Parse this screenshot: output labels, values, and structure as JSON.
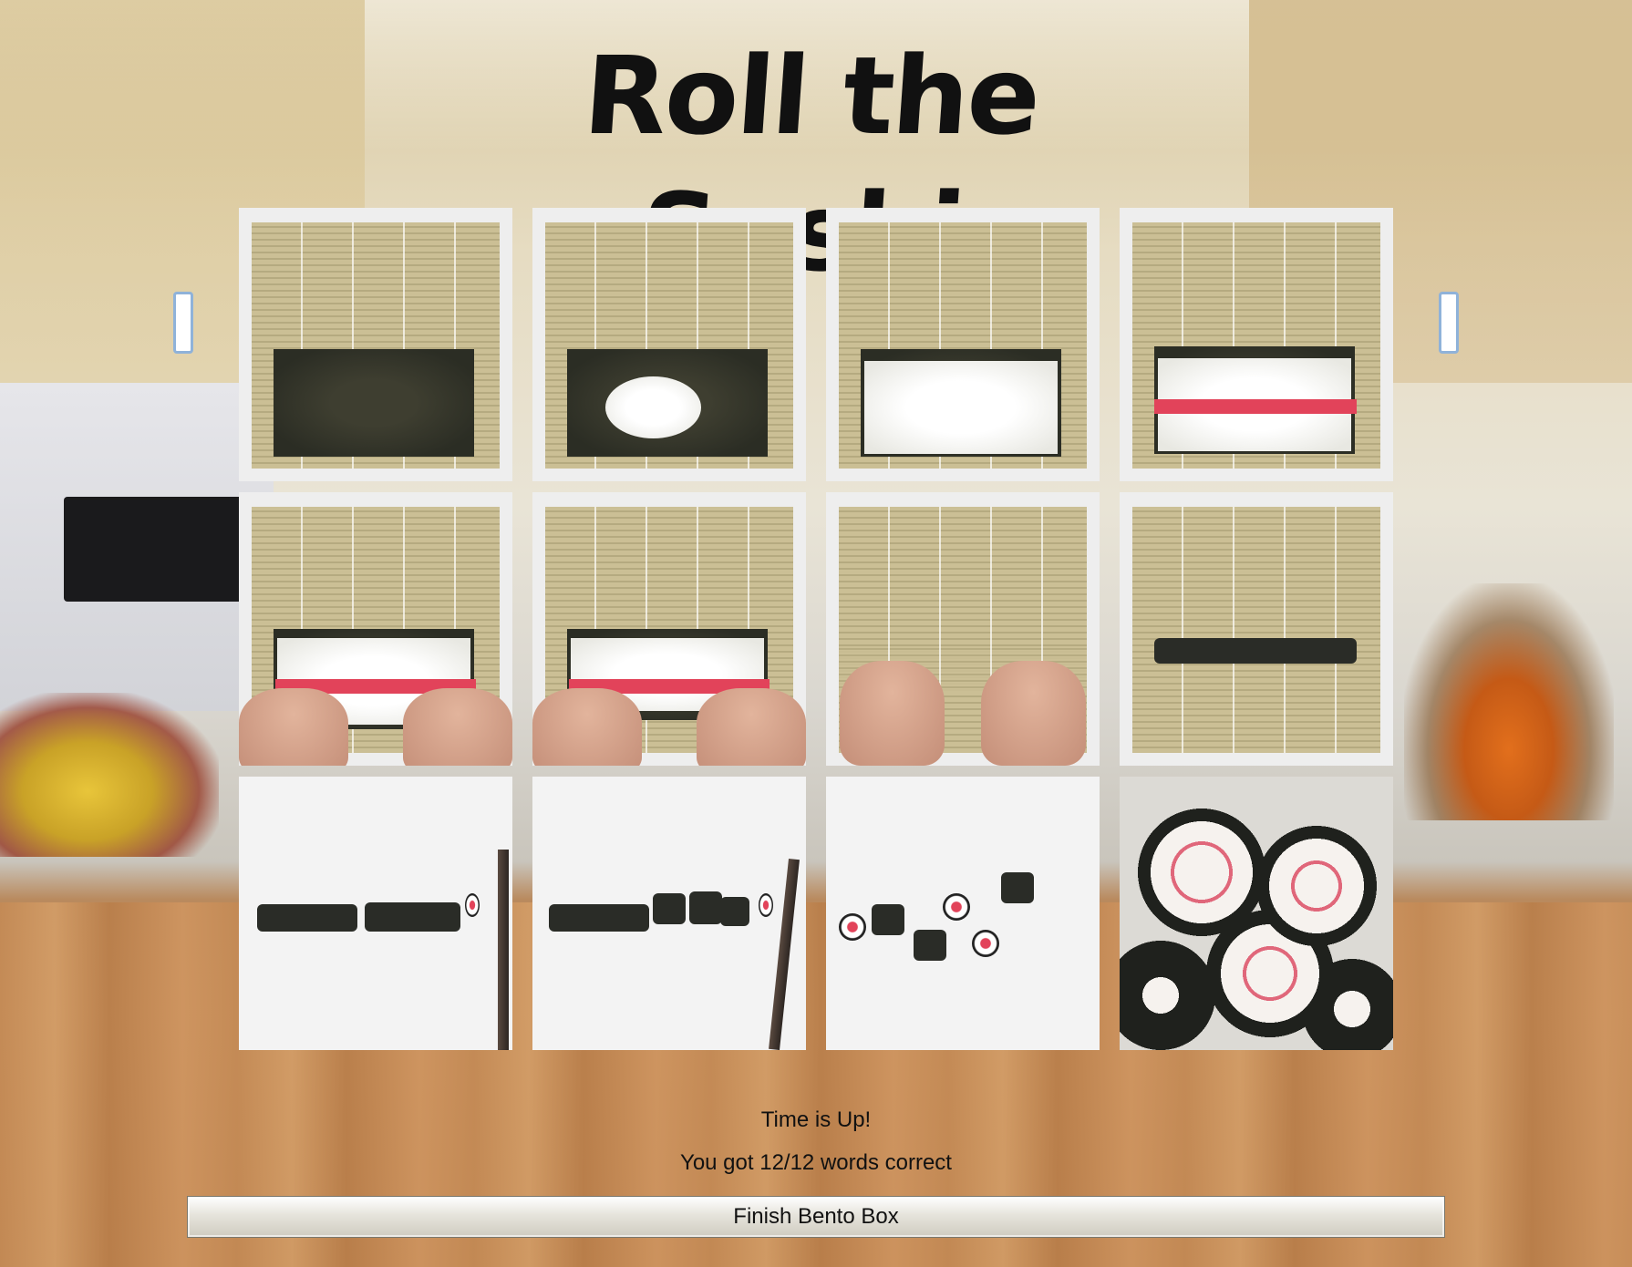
{
  "game": {
    "title": "Roll the Sushi"
  },
  "tiles": [
    {
      "name": "step-nori-on-mat"
    },
    {
      "name": "step-rice-ball-on-nori"
    },
    {
      "name": "step-rice-spread"
    },
    {
      "name": "step-tuna-added"
    },
    {
      "name": "step-begin-rolling"
    },
    {
      "name": "step-rolling-tight"
    },
    {
      "name": "step-roll-under-mat"
    },
    {
      "name": "step-finished-roll"
    },
    {
      "name": "step-cut-roll-half"
    },
    {
      "name": "step-cut-pieces"
    },
    {
      "name": "step-pieces-scattered"
    },
    {
      "name": "step-maki-plated"
    }
  ],
  "result": {
    "time_message": "Time is Up!",
    "score_message": "You got 12/12 words correct"
  },
  "actions": {
    "finish_label": "Finish Bento Box"
  }
}
